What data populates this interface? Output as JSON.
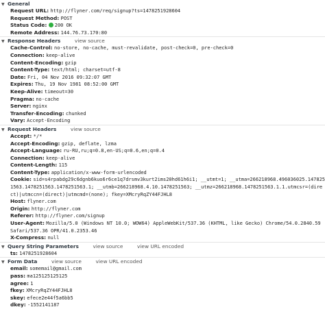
{
  "colors": {
    "status_ok": "#2eaf3f",
    "header_text": "#303942",
    "border": "#e4e4e4"
  },
  "general": {
    "title": "General",
    "request_url_k": "Request URL:",
    "request_url": "http://flyner.com/req/signup?ts=1478251928604",
    "method_k": "Request Method:",
    "method": "POST",
    "status_k": "Status Code:",
    "status": "200 OK",
    "remote_k": "Remote Address:",
    "remote": "144.76.73.170:80"
  },
  "response_headers": {
    "title": "Response Headers",
    "view_source": "view source",
    "rows": [
      {
        "k": "Cache-Control:",
        "v": "no-store, no-cache, must-revalidate, post-check=0, pre-check=0"
      },
      {
        "k": "Connection:",
        "v": "keep-alive"
      },
      {
        "k": "Content-Encoding:",
        "v": "gzip"
      },
      {
        "k": "Content-Type:",
        "v": "text/html; charset=utf-8"
      },
      {
        "k": "Date:",
        "v": "Fri, 04 Nov 2016 09:32:07 GMT"
      },
      {
        "k": "Expires:",
        "v": "Thu, 19 Nov 1981 08:52:00 GMT"
      },
      {
        "k": "Keep-Alive:",
        "v": "timeout=30"
      },
      {
        "k": "Pragma:",
        "v": "no-cache"
      },
      {
        "k": "Server:",
        "v": "nginx"
      },
      {
        "k": "Transfer-Encoding:",
        "v": "chunked"
      },
      {
        "k": "Vary:",
        "v": "Accept-Encoding"
      }
    ]
  },
  "request_headers": {
    "title": "Request Headers",
    "view_source": "view source",
    "rows": [
      {
        "k": "Accept:",
        "v": "*/*"
      },
      {
        "k": "Accept-Encoding:",
        "v": "gzip, deflate, lzma"
      },
      {
        "k": "Accept-Language:",
        "v": "ru-RU,ru;q=0.8,en-US;q=0.6,en;q=0.4"
      },
      {
        "k": "Connection:",
        "v": "keep-alive"
      },
      {
        "k": "Content-Length:",
        "v": "115"
      },
      {
        "k": "Content-Type:",
        "v": "application/x-www-form-urlencoded"
      },
      {
        "k": "Cookie:",
        "v": "sid=s4rpabdg29c6dgnb6kuo6r6ce1q7drsmv3kurt2ims20hd61h6i1; __utmt=1; __utma=266218968.496036025.1478251563.1478251563.1478251563.1; __utmb=266218968.4.10.1478251563; __utmz=266218968.1478251563.1.1.utmcsr=(direct)|utmccn=(direct)|utmcmd=(none); fkey=XMcryRqZY44FJHL8"
      },
      {
        "k": "Host:",
        "v": "flyner.com"
      },
      {
        "k": "Origin:",
        "v": "http://flyner.com"
      },
      {
        "k": "Referer:",
        "v": "http://flyner.com/signup"
      },
      {
        "k": "User-Agent:",
        "v": "Mozilla/5.0 (Windows NT 10.0; WOW64) AppleWebKit/537.36 (KHTML, like Gecko) Chrome/54.0.2840.59 Safari/537.36 OPR/41.0.2353.46"
      },
      {
        "k": "X-Compress:",
        "v": "null"
      }
    ]
  },
  "query_string": {
    "title": "Query String Parameters",
    "view_source": "view source",
    "view_url_encoded": "view URL encoded",
    "rows": [
      {
        "k": "ts:",
        "v": "1478251928604"
      }
    ]
  },
  "form_data": {
    "title": "Form Data",
    "view_source": "view source",
    "view_url_encoded": "view URL encoded",
    "rows": [
      {
        "k": "email:",
        "v": "somemail@gmail.com"
      },
      {
        "k": "pass:",
        "v": "ma125125125125"
      },
      {
        "k": "agree:",
        "v": "1"
      },
      {
        "k": "fkey:",
        "v": "XMcryRqZY44FJHL8"
      },
      {
        "k": "skey:",
        "v": "efece2e44f5a6bb5"
      },
      {
        "k": "dkey:",
        "v": "-1552141187"
      }
    ]
  }
}
